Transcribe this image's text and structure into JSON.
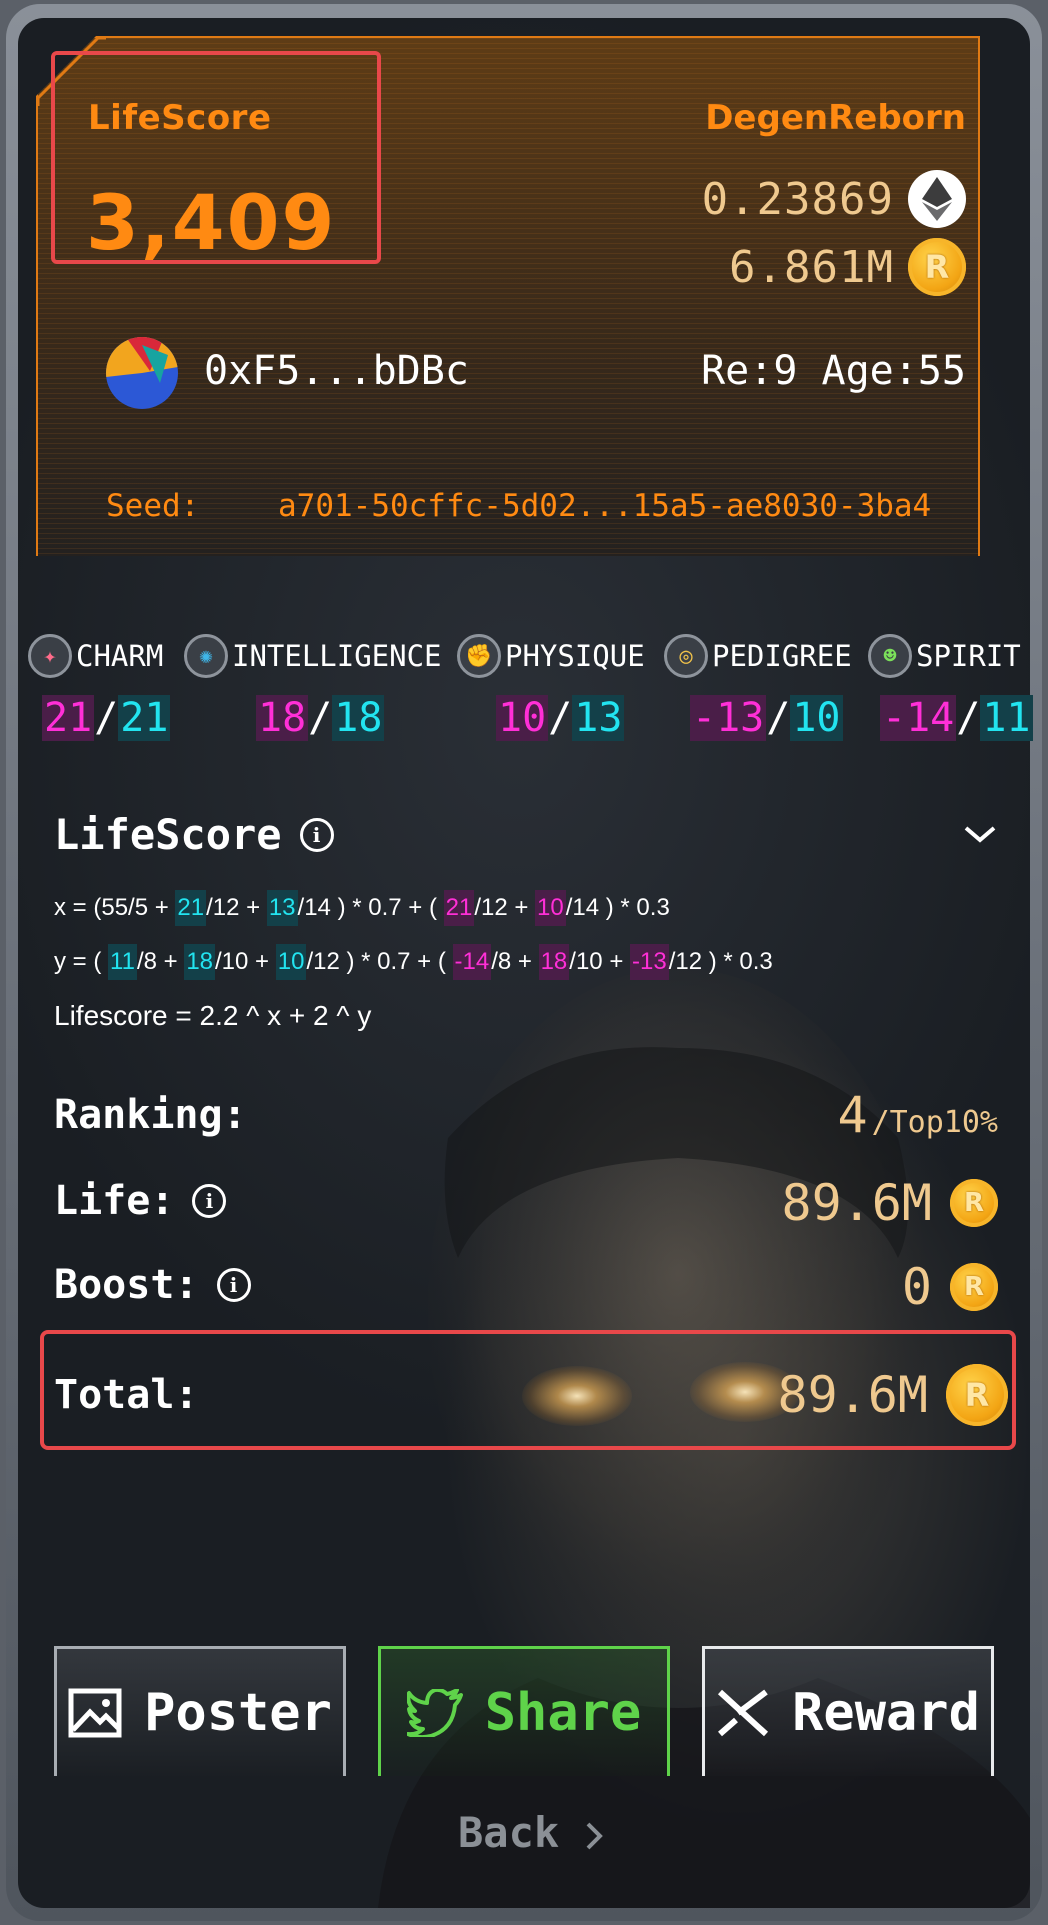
{
  "header": {
    "lifescore_label": "LifeScore",
    "lifescore_value": "3,409",
    "brand": "DegenReborn",
    "eth_balance": "0.23869",
    "reborn_balance": "6.861M",
    "address": "0xF5...bDBc",
    "re_age": "Re:9 Age:55",
    "seed_label": "Seed:",
    "seed_value": "a701-50cffc-5d02...15a5-ae8030-3ba4"
  },
  "coin_glyph": "R",
  "stats": [
    {
      "name": "CHARM",
      "icon": "sparkle-icon",
      "a": "21",
      "b": "21"
    },
    {
      "name": "INTELLIGENCE",
      "icon": "brain-icon",
      "a": "18",
      "b": "18"
    },
    {
      "name": "PHYSIQUE",
      "icon": "muscle-icon",
      "a": "10",
      "b": "13"
    },
    {
      "name": "PEDIGREE",
      "icon": "coins-icon",
      "a": "-13",
      "b": "10"
    },
    {
      "name": "SPIRIT",
      "icon": "smiley-icon",
      "a": "-14",
      "b": "11"
    }
  ],
  "formula": {
    "title": "LifeScore",
    "x": {
      "p1": "x = (55/5 + ",
      "v1": "21",
      "p2": "/12 + ",
      "v2": "13",
      "p3": "/14 ) * 0.7 + ( ",
      "v3": "21",
      "p4": "/12 + ",
      "v4": "10",
      "p5": "/14 ) * 0.3"
    },
    "y": {
      "p1": "y = ( ",
      "v1": "11",
      "p2": "/8 + ",
      "v2": "18",
      "p3": "/10 + ",
      "v3": "10",
      "p4": "/12 ) * 0.7 + ( ",
      "v4": "-14",
      "p5": "/8 + ",
      "v5": "18",
      "p6": "/10 + ",
      "v6": "-13",
      "p7": "/12 ) * 0.3"
    },
    "lifescore": "Lifescore = 2.2 ^ x + 2 ^ y"
  },
  "ranking": {
    "label": "Ranking:",
    "rank": "4",
    "suffix": "/Top10%"
  },
  "life": {
    "label": "Life:",
    "value": "89.6M"
  },
  "boost": {
    "label": "Boost:",
    "value": "0"
  },
  "total": {
    "label": "Total:",
    "value": "89.6M"
  },
  "buttons": {
    "poster": "Poster",
    "share": "Share",
    "reward": "Reward"
  },
  "back": "Back"
}
